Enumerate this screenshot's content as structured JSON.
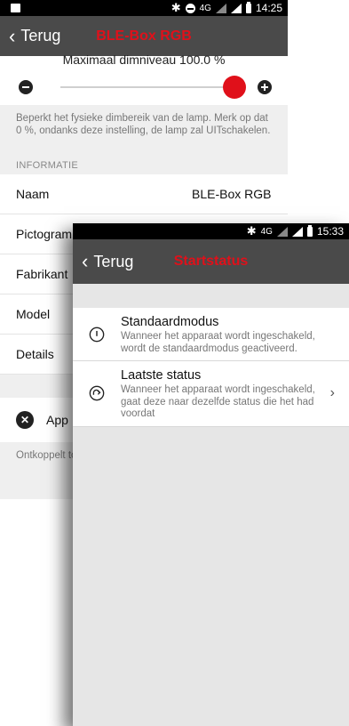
{
  "back_screen": {
    "status": {
      "time": "14:25",
      "network": "4G"
    },
    "toolbar": {
      "back_label": "Terug",
      "title": "BLE-Box RGB"
    },
    "slider": {
      "caption": "Maximaal dimniveau   100.0 %",
      "value_percent": 100
    },
    "slider_description": "Beperkt het fysieke dimbereik van de lamp. Merk op dat 0 %, ondanks deze instelling, de lamp zal UITschakelen.",
    "info_section_title": "INFORMATIE",
    "info_rows": [
      {
        "label": "Naam",
        "value": "BLE-Box RGB"
      },
      {
        "label": "Pictogram",
        "value": ""
      },
      {
        "label": "Fabrikant",
        "value": ""
      },
      {
        "label": "Model",
        "value": ""
      },
      {
        "label": "Details",
        "value": ""
      }
    ],
    "disconnect_row_label": "App",
    "disconnect_text": "Ontkoppelt toegevoegd"
  },
  "front_screen": {
    "status": {
      "time": "15:33",
      "network": "4G"
    },
    "toolbar": {
      "back_label": "Terug",
      "title": "Startstatus"
    },
    "modes": [
      {
        "title": "Standaardmodus",
        "description": "Wanneer het apparaat wordt ingeschakeld, wordt de standaardmodus geactiveerd.",
        "icon": "power-icon",
        "has_arrow": false
      },
      {
        "title": "Laatste status",
        "description": "Wanneer het apparaat wordt ingeschakeld, gaat deze naar dezelfde status die het had voordat",
        "icon": "redo-icon",
        "has_arrow": true
      }
    ]
  },
  "colors": {
    "accent": "#e0101a",
    "toolbar": "#4a4a4a",
    "background": "#efefef"
  }
}
